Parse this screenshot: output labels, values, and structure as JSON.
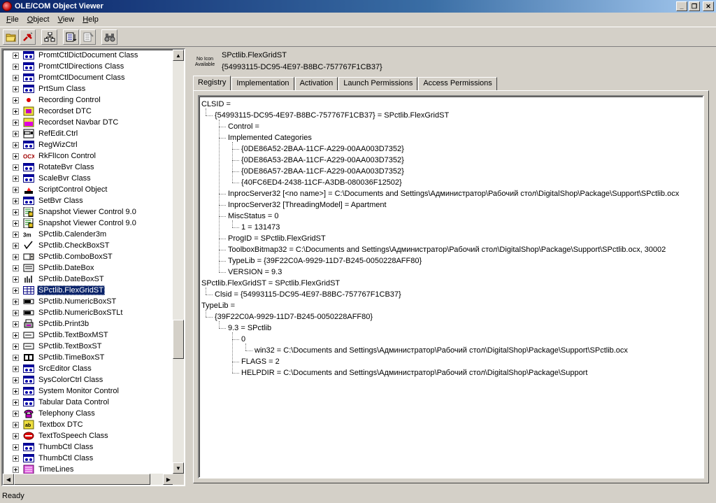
{
  "window": {
    "title": "OLE/COM Object Viewer"
  },
  "menu": [
    {
      "label": "File",
      "accel": "F",
      "rest": "ile"
    },
    {
      "label": "Object",
      "accel": "O",
      "rest": "bject"
    },
    {
      "label": "View",
      "accel": "V",
      "rest": "iew"
    },
    {
      "label": "Help",
      "accel": "H",
      "rest": "elp"
    }
  ],
  "toolbar": {
    "icons": [
      "open-folder-icon",
      "connect-icon",
      "hierarchy-icon",
      "expert-mode-icon",
      "copy-clsid-icon",
      "binoculars-icon"
    ]
  },
  "tree": {
    "items": [
      {
        "label": "PromtCtlDictDocument Class",
        "icon": "control"
      },
      {
        "label": "PromtCtlDirections Class",
        "icon": "control"
      },
      {
        "label": "PromtCtlDocument Class",
        "icon": "control"
      },
      {
        "label": "PrtSum Class",
        "icon": "control"
      },
      {
        "label": "Recording Control",
        "icon": "dot"
      },
      {
        "label": "Recordset DTC",
        "icon": "dtc"
      },
      {
        "label": "Recordset Navbar DTC",
        "icon": "navbar"
      },
      {
        "label": "RefEdit.Ctrl",
        "icon": "refedit"
      },
      {
        "label": "RegWizCtrl",
        "icon": "control"
      },
      {
        "label": "RkFlIcon Control",
        "icon": "ocx"
      },
      {
        "label": "RotateBvr Class",
        "icon": "control"
      },
      {
        "label": "ScaleBvr Class",
        "icon": "control"
      },
      {
        "label": "ScriptControl Object",
        "icon": "script"
      },
      {
        "label": "SetBvr Class",
        "icon": "control"
      },
      {
        "label": "Snapshot Viewer Control 9.0",
        "icon": "snapshot"
      },
      {
        "label": "Snapshot Viewer Control 9.0",
        "icon": "snapshot"
      },
      {
        "label": "SPctlib.Calender3m",
        "icon": "calender"
      },
      {
        "label": "SPctlib.CheckBoxST",
        "icon": "checkbox"
      },
      {
        "label": "SPctlib.ComboBoxST",
        "icon": "combobox"
      },
      {
        "label": "SPctlib.DateBox",
        "icon": "datebox"
      },
      {
        "label": "SPctlib.DateBoxST",
        "icon": "dateboxst"
      },
      {
        "label": "SPctlib.FlexGridST",
        "icon": "grid",
        "selected": true
      },
      {
        "label": "SPctlib.NumericBoxST",
        "icon": "numeric"
      },
      {
        "label": "SPctlib.NumericBoxSTLt",
        "icon": "numeric"
      },
      {
        "label": "SPctlib.Print3b",
        "icon": "print"
      },
      {
        "label": "SPctlib.TextBoxMST",
        "icon": "textbox"
      },
      {
        "label": "SPctlib.TextBoxST",
        "icon": "textbox"
      },
      {
        "label": "SPctlib.TimeBoxST",
        "icon": "timebox"
      },
      {
        "label": "SrcEditor Class",
        "icon": "control"
      },
      {
        "label": "SysColorCtrl Class",
        "icon": "control"
      },
      {
        "label": "System Monitor Control",
        "icon": "control"
      },
      {
        "label": "Tabular Data Control",
        "icon": "control"
      },
      {
        "label": "Telephony Class",
        "icon": "telephony"
      },
      {
        "label": "Textbox DTC",
        "icon": "textboxdtc"
      },
      {
        "label": "TextToSpeech Class",
        "icon": "speech"
      },
      {
        "label": "ThumbCtl Class",
        "icon": "control"
      },
      {
        "label": "ThumbCtl Class",
        "icon": "control"
      },
      {
        "label": "TimeLines",
        "icon": "timelines"
      }
    ]
  },
  "header": {
    "noicon_line1": "No Icon",
    "noicon_line2": "Available",
    "name": "SPctlib.FlexGridST",
    "clsid": "{54993115-DC95-4E97-B8BC-757767F1CB37}"
  },
  "tabs": [
    "Registry",
    "Implementation",
    "Activation",
    "Launch Permissions",
    "Access Permissions"
  ],
  "registry": [
    {
      "text": "CLSID =",
      "level": 0
    },
    {
      "text": "{54993115-DC95-4E97-B8BC-757767F1CB37} = SPctlib.FlexGridST",
      "level": 1
    },
    {
      "text": "Control =",
      "level": 2
    },
    {
      "text": "Implemented Categories",
      "level": 2
    },
    {
      "text": "{0DE86A52-2BAA-11CF-A229-00AA003D7352}",
      "level": 3
    },
    {
      "text": "{0DE86A53-2BAA-11CF-A229-00AA003D7352}",
      "level": 3
    },
    {
      "text": "{0DE86A57-2BAA-11CF-A229-00AA003D7352}",
      "level": 3
    },
    {
      "text": "{40FC6ED4-2438-11CF-A3DB-080036F12502}",
      "level": 3
    },
    {
      "text": "InprocServer32 [<no name>] = C:\\Documents and Settings\\Администратор\\Рабочий стол\\DigitalShop\\Package\\Support\\SPctlib.ocx",
      "level": 2
    },
    {
      "text": "InprocServer32 [ThreadingModel] = Apartment",
      "level": 2
    },
    {
      "text": "MiscStatus = 0",
      "level": 2
    },
    {
      "text": "1 = 131473",
      "level": 3
    },
    {
      "text": "ProgID = SPctlib.FlexGridST",
      "level": 2
    },
    {
      "text": "ToolboxBitmap32 = C:\\Documents and Settings\\Администратор\\Рабочий стол\\DigitalShop\\Package\\Support\\SPctlib.ocx, 30002",
      "level": 2
    },
    {
      "text": "TypeLib = {39F22C0A-9929-11D7-B245-0050228AFF80}",
      "level": 2
    },
    {
      "text": "VERSION = 9.3",
      "level": 2
    },
    {
      "text": "SPctlib.FlexGridST = SPctlib.FlexGridST",
      "level": 0
    },
    {
      "text": "Clsid = {54993115-DC95-4E97-B8BC-757767F1CB37}",
      "level": 1
    },
    {
      "text": "TypeLib =",
      "level": 0
    },
    {
      "text": "{39F22C0A-9929-11D7-B245-0050228AFF80}",
      "level": 1
    },
    {
      "text": "9.3 = SPctlib",
      "level": 2
    },
    {
      "text": "0",
      "level": 3
    },
    {
      "text": "win32 = C:\\Documents and Settings\\Администратор\\Рабочий стол\\DigitalShop\\Package\\Support\\SPctlib.ocx",
      "level": 4
    },
    {
      "text": "FLAGS = 2",
      "level": 3
    },
    {
      "text": "HELPDIR = C:\\Documents and Settings\\Администратор\\Рабочий стол\\DigitalShop\\Package\\Support",
      "level": 3
    }
  ],
  "status": {
    "text": "Ready"
  },
  "colors": {
    "selection": "#0a246a",
    "face": "#d4d0c8"
  }
}
